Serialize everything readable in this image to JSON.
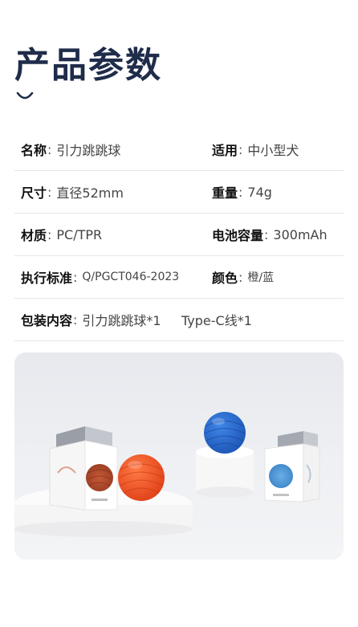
{
  "page": {
    "title": "产品参数"
  },
  "specs": [
    {
      "left": {
        "label": "名称",
        "sep": ":",
        "value": "引力跳跳球"
      },
      "right": {
        "label": "适用",
        "sep": ":",
        "value": "中小型犬"
      }
    },
    {
      "left": {
        "label": "尺寸",
        "sep": ":",
        "value": "直径52mm"
      },
      "right": {
        "label": "重量",
        "sep": ":",
        "value": "74g"
      }
    },
    {
      "left": {
        "label": "材质",
        "sep": ":",
        "value": "PC/TPR"
      },
      "right": {
        "label": "电池容量",
        "sep": ":",
        "value": "300mAh"
      }
    },
    {
      "left": {
        "label": "执行标准",
        "sep": ":",
        "value": "Q/PGCT046-2023"
      },
      "right": {
        "label": "颜色",
        "sep": ":",
        "value": "橙/蓝"
      }
    },
    {
      "left": {
        "label": "包装内容",
        "sep": ":",
        "value": "引力跳跳球*1     Type-C线*1"
      },
      "right": null
    }
  ],
  "colors": {
    "title": "#1f2c4a",
    "ball_orange": "#f0582a",
    "ball_blue": "#2f6fd0"
  }
}
